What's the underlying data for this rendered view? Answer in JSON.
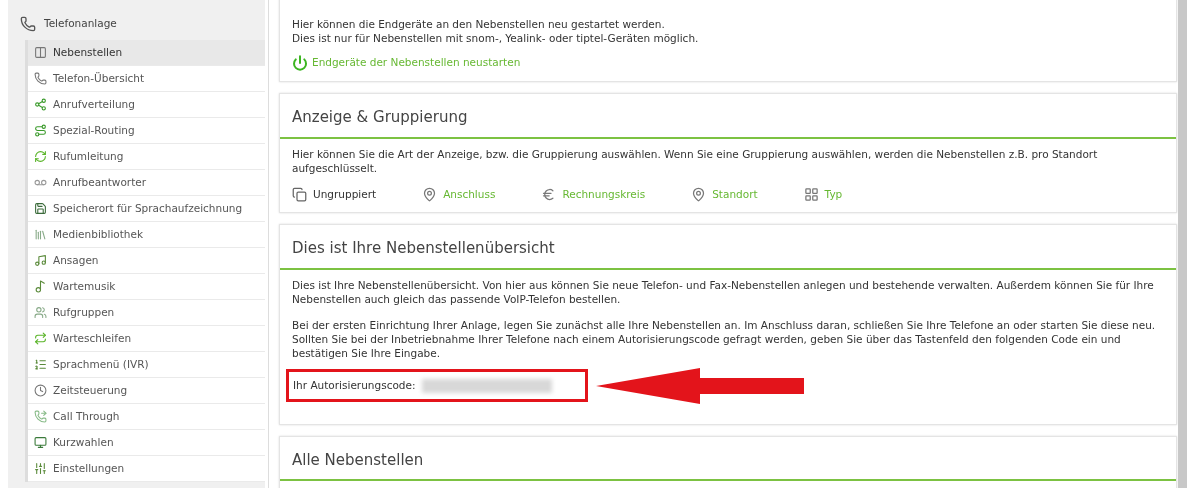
{
  "sidebar": {
    "header": "Telefonanlage",
    "items": [
      {
        "label": "Nebenstellen",
        "selected": true
      },
      {
        "label": "Telefon-Übersicht",
        "selected": false
      },
      {
        "label": "Anrufverteilung",
        "selected": false
      },
      {
        "label": "Spezial-Routing",
        "selected": false
      },
      {
        "label": "Rufumleitung",
        "selected": false
      },
      {
        "label": "Anrufbeantworter",
        "selected": false
      },
      {
        "label": "Speicherort für Sprachaufzeichnung",
        "selected": false
      },
      {
        "label": "Medienbibliothek",
        "selected": false
      },
      {
        "label": "Ansagen",
        "selected": false
      },
      {
        "label": "Wartemusik",
        "selected": false
      },
      {
        "label": "Rufgruppen",
        "selected": false
      },
      {
        "label": "Warteschleifen",
        "selected": false
      },
      {
        "label": "Sprachmenü (IVR)",
        "selected": false
      },
      {
        "label": "Zeitsteuerung",
        "selected": false
      },
      {
        "label": "Call Through",
        "selected": false
      },
      {
        "label": "Kurzwahlen",
        "selected": false
      },
      {
        "label": "Einstellungen",
        "selected": false
      }
    ]
  },
  "restart_panel": {
    "lines": [
      "Hier können die Endgeräte an den Nebenstellen neu gestartet werden.",
      "Dies ist nur für Nebenstellen mit snom-, Yealink- oder tiptel-Geräten möglich."
    ],
    "link": "Endgeräte der Nebenstellen neustarten"
  },
  "grouping_panel": {
    "title": "Anzeige & Gruppierung",
    "text": "Hier können Sie die Art der Anzeige, bzw. die Gruppierung auswählen. Wenn Sie eine Gruppierung auswählen, werden die Nebenstellen z.B. pro Standort aufgeschlüsselt.",
    "options": [
      {
        "label": "Ungruppiert",
        "selected": true
      },
      {
        "label": "Anschluss",
        "selected": false
      },
      {
        "label": "Rechnungskreis",
        "selected": false
      },
      {
        "label": "Standort",
        "selected": false
      },
      {
        "label": "Typ",
        "selected": false
      }
    ]
  },
  "overview_panel": {
    "title": "Dies ist Ihre Nebenstellenübersicht",
    "paragraphs": [
      "Dies ist Ihre Nebenstellenübersicht. Von hier aus können Sie neue Telefon- und Fax-Nebenstellen anlegen und bestehende verwalten. Außerdem können Sie für Ihre Nebenstellen auch gleich das passende VoIP-Telefon bestellen.",
      "Bei der ersten Einrichtung Ihrer Anlage, legen Sie zunächst alle Ihre Nebenstellen an. Im Anschluss daran, schließen Sie Ihre Telefone an oder starten Sie diese neu. Sollten Sie bei der Inbetriebnahme Ihrer Telefone nach einem Autorisierungscode gefragt werden, geben Sie über das Tastenfeld den folgenden Code ein und bestätigen Sie Ihre Eingabe."
    ],
    "auth_label": "Ihr Autorisierungscode:"
  },
  "extensions_panel": {
    "title": "Alle Nebenstellen"
  }
}
